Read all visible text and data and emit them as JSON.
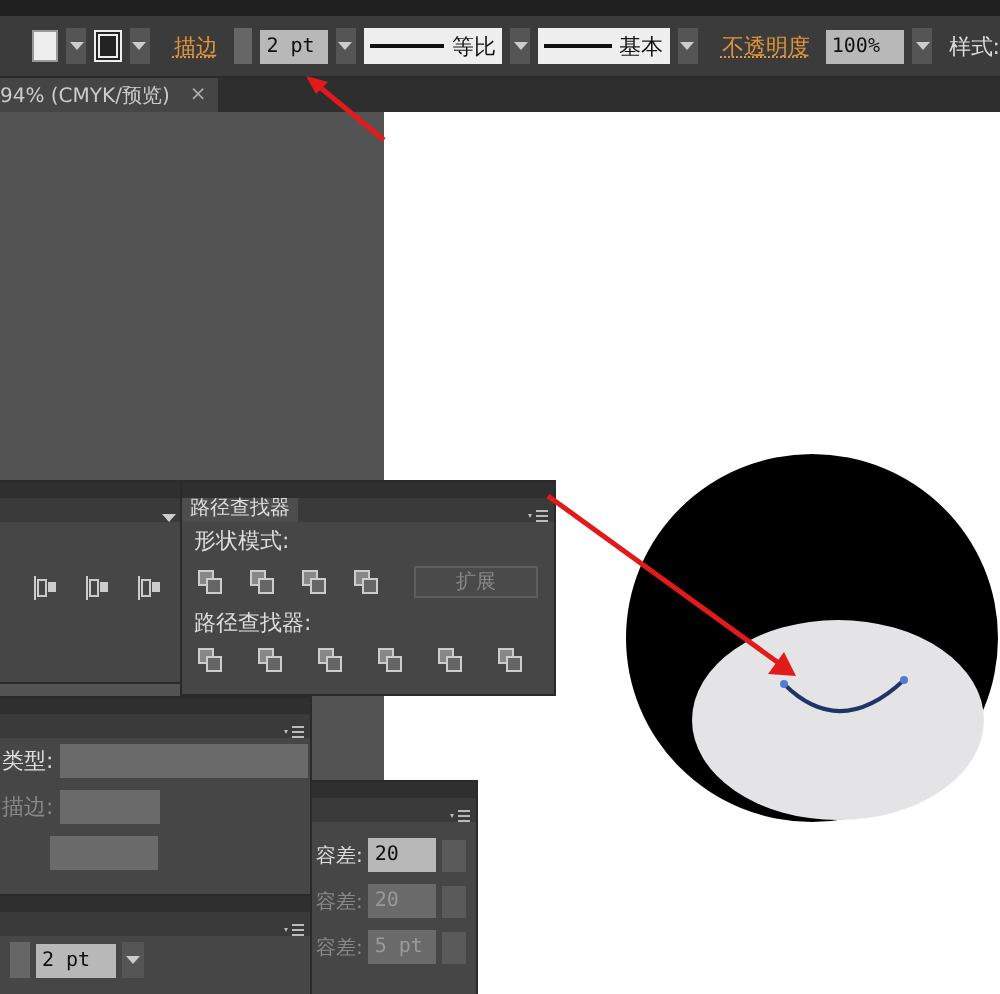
{
  "control_bar": {
    "stroke_label": "描边",
    "stroke_weight": "2 pt",
    "profile": "等比",
    "brush": "基本",
    "opacity_label": "不透明度",
    "opacity": "100%",
    "style_label": "样式:"
  },
  "document_tab": {
    "title": "94% (CMYK/预览)",
    "close": "×"
  },
  "pathfinder_panel": {
    "tab": "路径查找器",
    "shape_modes_label": "形状模式:",
    "expand_button": {
      "label": "扩展",
      "disabled": true
    },
    "pathfinders_label": "路径查找器:"
  },
  "stroke_panel": {
    "type_label": "类型:",
    "stroke_label": "描边:"
  },
  "magic_wand_panel": {
    "rows": [
      {
        "label": "容差:",
        "value": "20",
        "disabled": false
      },
      {
        "label": "容差:",
        "value": "20",
        "disabled": true
      },
      {
        "label": "容差:",
        "value": "5 pt",
        "disabled": true
      }
    ]
  },
  "bottom_panel": {
    "value": "2 pt"
  }
}
